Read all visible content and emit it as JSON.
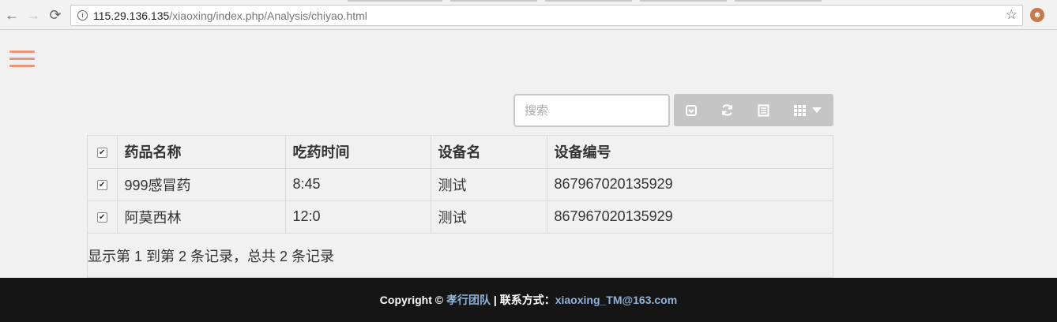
{
  "browser": {
    "back_glyph": "←",
    "forward_glyph": "→",
    "reload_glyph": "⟳",
    "info_glyph": "i",
    "url_host": "115.29.136.135",
    "url_path": "/xiaoxing/index.php/Analysis/chiyao.html",
    "star_glyph": "☆",
    "extension_glyph": "☻"
  },
  "sidebar_toggle": {
    "icon": "hamburger-menu-icon",
    "color": "#e9967a"
  },
  "search": {
    "placeholder": "搜索",
    "value": ""
  },
  "toolbar": {
    "buttons": [
      "toggle-pagination-icon",
      "refresh-icon",
      "toggle-view-icon",
      "columns-icon"
    ],
    "color": "#c5c5c5"
  },
  "table": {
    "columns": [
      "药品名称",
      "吃药时间",
      "设备名",
      "设备编号"
    ],
    "header_checked": true,
    "rows": [
      {
        "checked": true,
        "cells": [
          "999感冒药",
          "8:45",
          "测试",
          "867967020135929"
        ]
      },
      {
        "checked": true,
        "cells": [
          "阿莫西林",
          "12:0",
          "测试",
          "867967020135929"
        ]
      }
    ],
    "pagination_text": "显示第 1 到第 2 条记录，总共 2 条记录"
  },
  "footer": {
    "copyright": "Copyright ©",
    "team": "孝行团队",
    "separator": " | 联系方式：",
    "email": "xiaoxing_TM@163.com",
    "background": "#151515",
    "link_color": "#8fb3d9"
  }
}
